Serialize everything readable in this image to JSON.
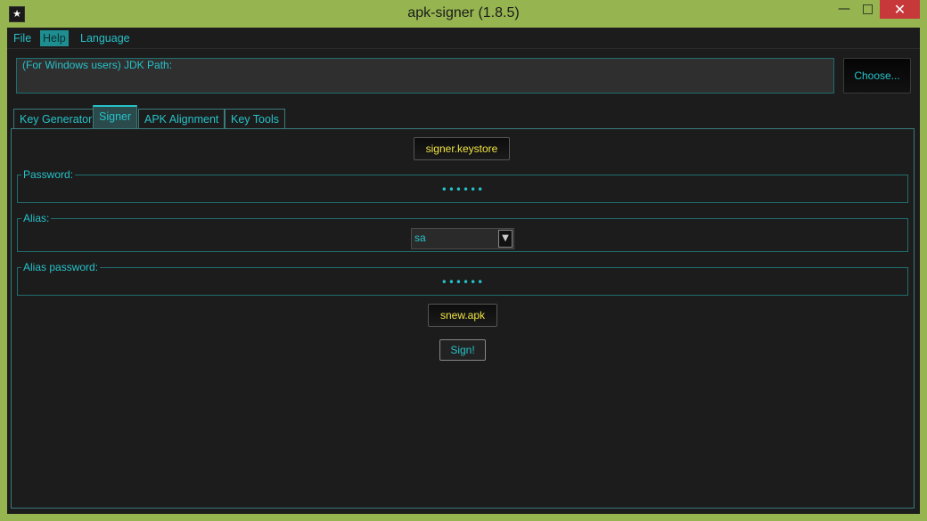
{
  "window": {
    "title": "apk-signer (1.8.5)",
    "min_glyph": "—",
    "max_glyph": "□",
    "close_glyph": "✕"
  },
  "menu": {
    "file": "File",
    "help": "Help",
    "language": "Language"
  },
  "jdk": {
    "legend": "(For Windows users) JDK Path:",
    "value": "",
    "choose_label": "Choose..."
  },
  "tabs": [
    {
      "label": "Key Generator"
    },
    {
      "label": "Signer"
    },
    {
      "label": "APK Alignment"
    },
    {
      "label": "Key Tools"
    }
  ],
  "signer": {
    "keystore_label": "signer.keystore",
    "password_legend": "Password:",
    "password_value": "••••••",
    "alias_legend": "Alias:",
    "alias_value": "sa",
    "alias_password_legend": "Alias password:",
    "alias_password_value": "••••••",
    "apk_label": "snew.apk",
    "sign_label": "Sign!"
  },
  "icons": {
    "app": "app-icon",
    "dropdown": "chevron-down-icon"
  },
  "colors": {
    "accent": "#26c2c9",
    "yellow_text": "#f0e442",
    "background": "#1c1c1c",
    "title_bar": "#96b550",
    "close": "#c7383a"
  }
}
